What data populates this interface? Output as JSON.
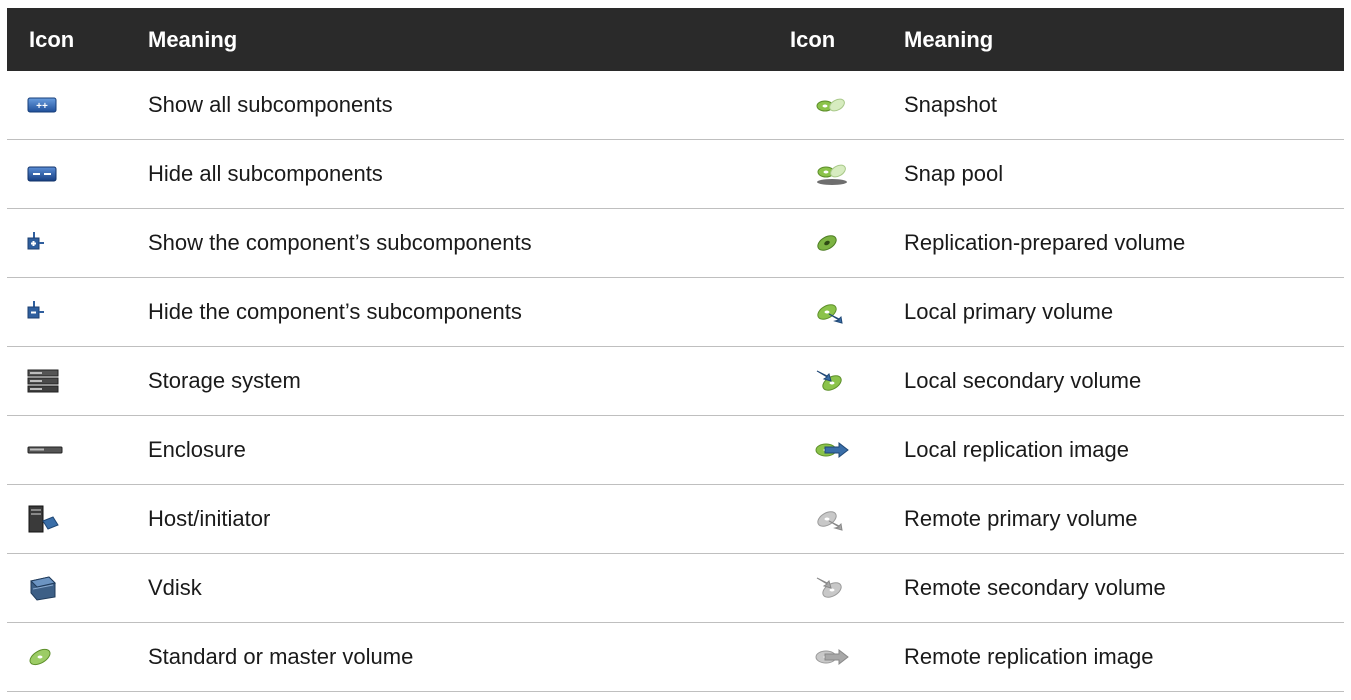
{
  "header": {
    "icon_left": "Icon",
    "meaning_left": "Meaning",
    "icon_right": "Icon",
    "meaning_right": "Meaning"
  },
  "rows": [
    {
      "left_icon": "show-all-subcomponents-icon",
      "left": "Show all subcomponents",
      "right_icon": "snapshot-icon",
      "right": "Snapshot"
    },
    {
      "left_icon": "hide-all-subcomponents-icon",
      "left": "Hide all subcomponents",
      "right_icon": "snap-pool-icon",
      "right": "Snap pool"
    },
    {
      "left_icon": "show-component-subcomponents-icon",
      "left": "Show the component’s subcomponents",
      "right_icon": "replication-prepared-volume-icon",
      "right": "Replication-prepared volume"
    },
    {
      "left_icon": "hide-component-subcomponents-icon",
      "left": "Hide the component’s subcomponents",
      "right_icon": "local-primary-volume-icon",
      "right": "Local primary volume"
    },
    {
      "left_icon": "storage-system-icon",
      "left": "Storage system",
      "right_icon": "local-secondary-volume-icon",
      "right": "Local secondary volume"
    },
    {
      "left_icon": "enclosure-icon",
      "left": "Enclosure",
      "right_icon": "local-replication-image-icon",
      "right": "Local replication image"
    },
    {
      "left_icon": "host-initiator-icon",
      "left": "Host/initiator",
      "right_icon": "remote-primary-volume-icon",
      "right": "Remote primary volume"
    },
    {
      "left_icon": "vdisk-icon",
      "left": "Vdisk",
      "right_icon": "remote-secondary-volume-icon",
      "right": "Remote secondary volume"
    },
    {
      "left_icon": "standard-master-volume-icon",
      "left": "Standard or master volume",
      "right_icon": "remote-replication-image-icon",
      "right": "Remote replication image"
    }
  ],
  "colors": {
    "header_bg": "#2a2a2a",
    "row_divider": "#bfbfbf",
    "volume_green": "#8bc34a",
    "blue_icon": "#2f5f9e",
    "gray_icon": "#9a9a9a"
  }
}
